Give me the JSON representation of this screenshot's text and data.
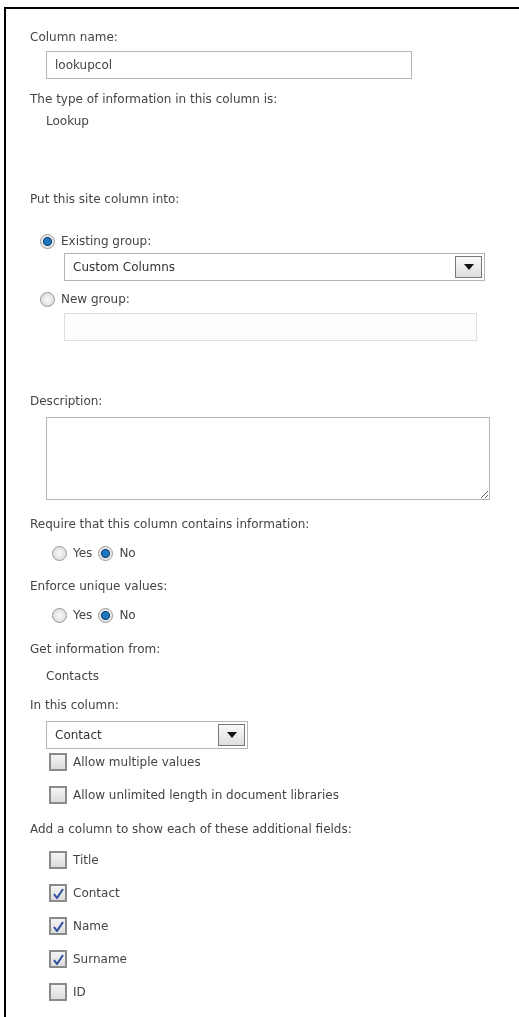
{
  "column_name": {
    "label": "Column name:",
    "value": "lookupcol"
  },
  "type_info": {
    "label": "The type of information in this column is:",
    "value": "Lookup"
  },
  "group": {
    "label": "Put this site column into:",
    "options": [
      {
        "label": "Existing group:",
        "selected": true,
        "kind": "select",
        "value": "Custom Columns"
      },
      {
        "label": "New group:",
        "selected": false,
        "kind": "text"
      }
    ]
  },
  "description": {
    "label": "Description:"
  },
  "require": {
    "label": "Require that this column contains information:",
    "options": [
      {
        "label": "Yes",
        "selected": false
      },
      {
        "label": "No",
        "selected": true
      }
    ]
  },
  "unique": {
    "label": "Enforce unique values:",
    "options": [
      {
        "label": "Yes",
        "selected": false
      },
      {
        "label": "No",
        "selected": true
      }
    ]
  },
  "source": {
    "label": "Get information from:",
    "value": "Contacts"
  },
  "in_column": {
    "label": "In this column:",
    "value": "Contact",
    "options": [
      {
        "label": "Allow multiple values",
        "checked": false
      },
      {
        "label": "Allow unlimited length in document libraries",
        "checked": false
      }
    ]
  },
  "additional": {
    "label": "Add a column to show each of these additional fields:",
    "fields": [
      {
        "label": "Title",
        "checked": false
      },
      {
        "label": "Contact",
        "checked": true
      },
      {
        "label": "Name",
        "checked": true
      },
      {
        "label": "Surname",
        "checked": true
      },
      {
        "label": "ID",
        "checked": false
      }
    ]
  }
}
